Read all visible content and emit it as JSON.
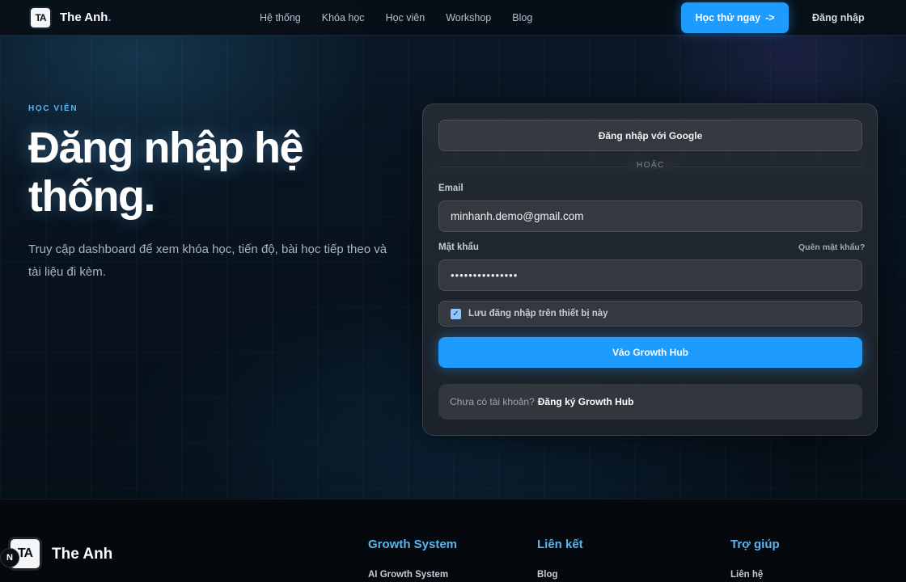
{
  "nav": {
    "logo_mark": "TA",
    "brand": "The Anh",
    "brand_dot": ".",
    "links": [
      "Hệ thống",
      "Khóa học",
      "Học viên",
      "Workshop",
      "Blog"
    ],
    "cta_label": "Học thử ngay",
    "cta_arrow": "->",
    "login_label": "Đăng nhập"
  },
  "hero": {
    "eyebrow": "HỌC VIÊN",
    "title": "Đăng nhập hệ thống.",
    "subtitle": "Truy cập dashboard để xem khóa học, tiến độ, bài học tiếp theo và tài liệu đi kèm."
  },
  "form": {
    "google_label": "Đăng nhập với Google",
    "divider": "HOẶC",
    "email_label": "Email",
    "email_value": "minhanh.demo@gmail.com",
    "password_label": "Mật khẩu",
    "password_value": "•••••••••••••••",
    "forgot_label": "Quên mật khẩu?",
    "remember_label": "Lưu đăng nhập trên thiết bị này",
    "remember_checked": true,
    "submit_label": "Vào Growth Hub",
    "signup_question": "Chưa có tài khoản?",
    "signup_link": "Đăng ký Growth Hub"
  },
  "footer": {
    "logo_mark": "TA",
    "badge": "N",
    "brand": "The Anh",
    "columns": [
      {
        "heading": "Growth System",
        "first_item": "AI Growth System"
      },
      {
        "heading": "Liên kết",
        "first_item": "Blog"
      },
      {
        "heading": "Trợ giúp",
        "first_item": "Liên hệ"
      }
    ]
  },
  "colors": {
    "accent": "#1e9bff",
    "eyebrow": "#58b6ef"
  }
}
